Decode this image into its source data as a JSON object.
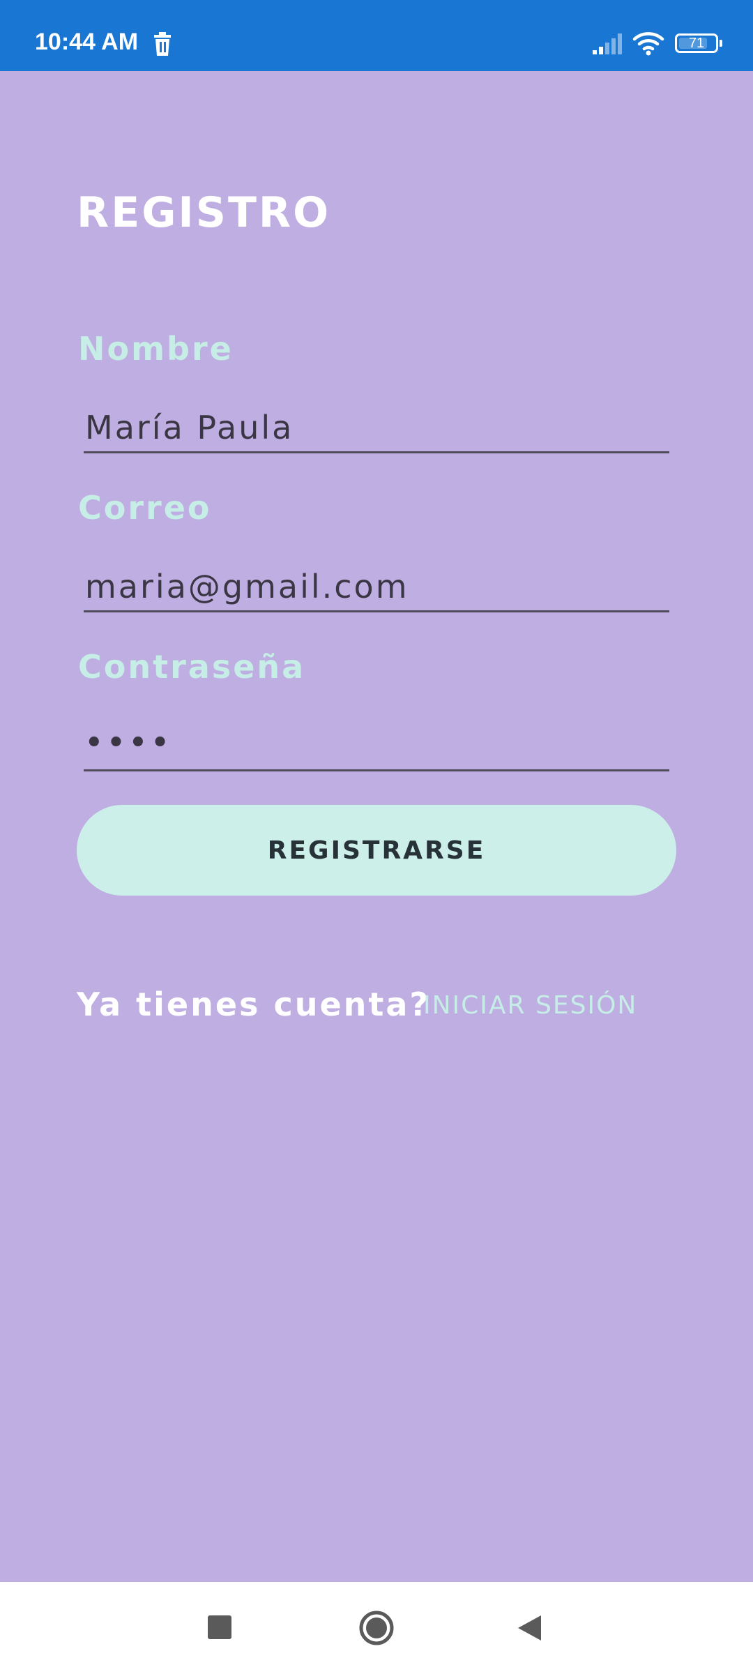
{
  "status_bar": {
    "time": "10:44 AM",
    "battery_level": "71",
    "icons": [
      "trash-icon",
      "signal-icon",
      "wifi-icon",
      "battery-icon"
    ],
    "background_color": "#1976d2"
  },
  "form": {
    "title": "REGISTRO",
    "fields": [
      {
        "label": "Nombre",
        "value": "María Paula"
      },
      {
        "label": "Correo",
        "value": "maria@gmail.com"
      },
      {
        "label": "Contraseña",
        "value": "••••"
      }
    ],
    "submit_label": "REGISTRARSE"
  },
  "footer": {
    "prompt": "Ya tienes cuenta?",
    "login_link": "INICIAR SESIÓN"
  },
  "nav_bar": {
    "icons": [
      "recents-icon",
      "home-icon",
      "back-icon"
    ]
  },
  "colors": {
    "background": "#bfaee2",
    "label": "#c6ede6",
    "button": "#cdefe9",
    "title": "#ffffff"
  }
}
